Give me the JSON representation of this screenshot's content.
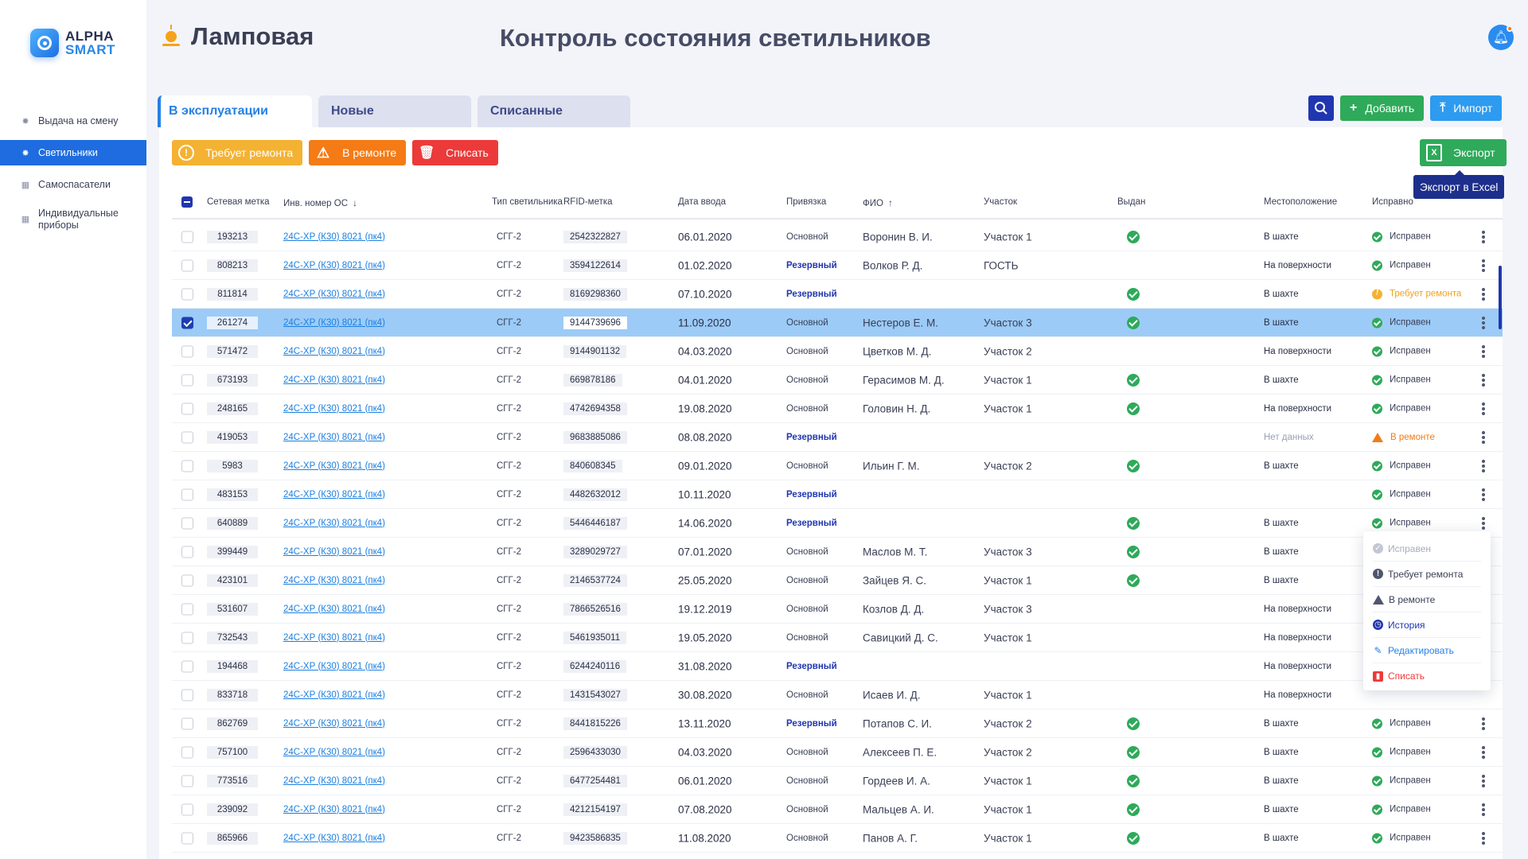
{
  "app": {
    "logo_line1": "ALPHA",
    "logo_line2": "SMART"
  },
  "sidebar": {
    "items": [
      {
        "label": "Выдача на смену",
        "icon": "lamp-icon",
        "active": false
      },
      {
        "label": "Светильники",
        "icon": "lamp-icon",
        "active": true
      },
      {
        "label": "Самоспасатели",
        "icon": "grid-icon",
        "active": false
      },
      {
        "label": "Индивидуальные приборы",
        "icon": "grid-icon",
        "active": false
      }
    ]
  },
  "header": {
    "section": "Ламповая",
    "title": "Контроль состояния светильников"
  },
  "tabs": [
    {
      "label": "В эксплуатации",
      "active": true
    },
    {
      "label": "Новые",
      "active": false
    },
    {
      "label": "Списанные",
      "active": false
    }
  ],
  "actions": {
    "add": "Добавить",
    "import": "Импорт",
    "export": "Экспорт",
    "export_tooltip": "Экспорт в Excel"
  },
  "filters": {
    "needs_repair": "Требует ремонта",
    "in_repair": "В ремонте",
    "write_off": "Списать"
  },
  "columns": {
    "net_tag": "Сетевая метка",
    "inv_no": "Инв. номер ОС",
    "type": "Тип светильника",
    "rfid": "RFID-метка",
    "date": "Дата ввода",
    "binding": "Привязка",
    "fio": "ФИО",
    "section": "Участок",
    "issued": "Выдан",
    "location": "Местоположение",
    "status": "Исправно"
  },
  "rows": [
    {
      "net": "193213",
      "inv": "24С-ХР (К30) 8021 (пк4)",
      "type": "СГГ-2",
      "rfid": "2542322827",
      "date": "06.01.2020",
      "bind": "Основной",
      "fio": "Воронин В. И.",
      "sec": "Участок 1",
      "issued": true,
      "loc": "В шахте",
      "status": "Исправен",
      "st": "ok",
      "selected": false
    },
    {
      "net": "808213",
      "inv": "24С-ХР (К30) 8021 (пк4)",
      "type": "СГГ-2",
      "rfid": "3594122614",
      "date": "01.02.2020",
      "bind": "Резервный",
      "fio": "Волков Р. Д.",
      "sec": "ГОСТЬ",
      "issued": false,
      "loc": "На поверхности",
      "status": "Исправен",
      "st": "ok",
      "selected": false
    },
    {
      "net": "811814",
      "inv": "24С-ХР (К30) 8021 (пк4)",
      "type": "СГГ-2",
      "rfid": "8169298360",
      "date": "07.10.2020",
      "bind": "Резервный",
      "fio": "",
      "sec": "",
      "issued": true,
      "loc": "В шахте",
      "status": "Требует ремонта",
      "st": "warn",
      "selected": false
    },
    {
      "net": "261274",
      "inv": "24С-ХР (К30) 8021 (пк4)",
      "type": "СГГ-2",
      "rfid": "9144739696",
      "date": "11.09.2020",
      "bind": "Основной",
      "fio": "Нестеров Е. М.",
      "sec": "Участок 3",
      "issued": true,
      "loc": "В шахте",
      "status": "Исправен",
      "st": "ok",
      "selected": true
    },
    {
      "net": "571472",
      "inv": "24С-ХР (К30) 8021 (пк4)",
      "type": "СГГ-2",
      "rfid": "9144901132",
      "date": "04.03.2020",
      "bind": "Основной",
      "fio": "Цветков М. Д.",
      "sec": "Участок 2",
      "issued": false,
      "loc": "На поверхности",
      "status": "Исправен",
      "st": "ok",
      "selected": false
    },
    {
      "net": "673193",
      "inv": "24С-ХР (К30) 8021 (пк4)",
      "type": "СГГ-2",
      "rfid": "669878186",
      "date": "04.01.2020",
      "bind": "Основной",
      "fio": "Герасимов М. Д.",
      "sec": "Участок 1",
      "issued": true,
      "loc": "В шахте",
      "status": "Исправен",
      "st": "ok",
      "selected": false
    },
    {
      "net": "248165",
      "inv": "24С-ХР (К30) 8021 (пк4)",
      "type": "СГГ-2",
      "rfid": "4742694358",
      "date": "19.08.2020",
      "bind": "Основной",
      "fio": "Головин Н. Д.",
      "sec": "Участок 1",
      "issued": true,
      "loc": "На поверхности",
      "status": "Исправен",
      "st": "ok",
      "selected": false
    },
    {
      "net": "419053",
      "inv": "24С-ХР (К30) 8021 (пк4)",
      "type": "СГГ-2",
      "rfid": "9683885086",
      "date": "08.08.2020",
      "bind": "Резервный",
      "fio": "",
      "sec": "",
      "issued": false,
      "loc": "Нет данных",
      "status": "В ремонте",
      "st": "rep",
      "selected": false
    },
    {
      "net": "5983",
      "inv": "24С-ХР (К30) 8021 (пк4)",
      "type": "СГГ-2",
      "rfid": "840608345",
      "date": "09.01.2020",
      "bind": "Основной",
      "fio": "Ильин Г. М.",
      "sec": "Участок 2",
      "issued": true,
      "loc": "В шахте",
      "status": "Исправен",
      "st": "ok",
      "selected": false
    },
    {
      "net": "483153",
      "inv": "24С-ХР (К30) 8021 (пк4)",
      "type": "СГГ-2",
      "rfid": "4482632012",
      "date": "10.11.2020",
      "bind": "Резервный",
      "fio": "",
      "sec": "",
      "issued": false,
      "loc": "",
      "status": "Исправен",
      "st": "ok",
      "selected": false
    },
    {
      "net": "640889",
      "inv": "24С-ХР (К30) 8021 (пк4)",
      "type": "СГГ-2",
      "rfid": "5446446187",
      "date": "14.06.2020",
      "bind": "Резервный",
      "fio": "",
      "sec": "",
      "issued": true,
      "loc": "В шахте",
      "status": "Исправен",
      "st": "ok",
      "selected": false
    },
    {
      "net": "399449",
      "inv": "24С-ХР (К30) 8021 (пк4)",
      "type": "СГГ-2",
      "rfid": "3289029727",
      "date": "07.01.2020",
      "bind": "Основной",
      "fio": "Маслов М. Т.",
      "sec": "Участок 3",
      "issued": true,
      "loc": "В шахте",
      "status": "",
      "st": "",
      "selected": false
    },
    {
      "net": "423101",
      "inv": "24С-ХР (К30) 8021 (пк4)",
      "type": "СГГ-2",
      "rfid": "2146537724",
      "date": "25.05.2020",
      "bind": "Основной",
      "fio": "Зайцев Я. С.",
      "sec": "Участок 1",
      "issued": true,
      "loc": "В шахте",
      "status": "",
      "st": "",
      "selected": false
    },
    {
      "net": "531607",
      "inv": "24С-ХР (К30) 8021 (пк4)",
      "type": "СГГ-2",
      "rfid": "7866526516",
      "date": "19.12.2019",
      "bind": "Основной",
      "fio": "Козлов Д. Д.",
      "sec": "Участок 3",
      "issued": false,
      "loc": "На поверхности",
      "status": "",
      "st": "",
      "selected": false
    },
    {
      "net": "732543",
      "inv": "24С-ХР (К30) 8021 (пк4)",
      "type": "СГГ-2",
      "rfid": "5461935011",
      "date": "19.05.2020",
      "bind": "Основной",
      "fio": "Савицкий Д. С.",
      "sec": "Участок 1",
      "issued": false,
      "loc": "На поверхности",
      "status": "",
      "st": "",
      "selected": false
    },
    {
      "net": "194468",
      "inv": "24С-ХР (К30) 8021 (пк4)",
      "type": "СГГ-2",
      "rfid": "6244240116",
      "date": "31.08.2020",
      "bind": "Резервный",
      "fio": "",
      "sec": "",
      "issued": false,
      "loc": "На поверхности",
      "status": "",
      "st": "",
      "selected": false
    },
    {
      "net": "833718",
      "inv": "24С-ХР (К30) 8021 (пк4)",
      "type": "СГГ-2",
      "rfid": "1431543027",
      "date": "30.08.2020",
      "bind": "Основной",
      "fio": "Исаев И. Д.",
      "sec": "Участок 1",
      "issued": false,
      "loc": "На поверхности",
      "status": "",
      "st": "",
      "selected": false
    },
    {
      "net": "862769",
      "inv": "24С-ХР (К30) 8021 (пк4)",
      "type": "СГГ-2",
      "rfid": "8441815226",
      "date": "13.11.2020",
      "bind": "Резервный",
      "fio": "Потапов С. И.",
      "sec": "Участок 2",
      "issued": true,
      "loc": "В шахте",
      "status": "Исправен",
      "st": "ok",
      "selected": false
    },
    {
      "net": "757100",
      "inv": "24С-ХР (К30) 8021 (пк4)",
      "type": "СГГ-2",
      "rfid": "2596433030",
      "date": "04.03.2020",
      "bind": "Основной",
      "fio": "Алексеев П. Е.",
      "sec": "Участок 2",
      "issued": true,
      "loc": "В шахте",
      "status": "Исправен",
      "st": "ok",
      "selected": false
    },
    {
      "net": "773516",
      "inv": "24С-ХР (К30) 8021 (пк4)",
      "type": "СГГ-2",
      "rfid": "6477254481",
      "date": "06.01.2020",
      "bind": "Основной",
      "fio": "Гордеев И. А.",
      "sec": "Участок 1",
      "issued": true,
      "loc": "В шахте",
      "status": "Исправен",
      "st": "ok",
      "selected": false
    },
    {
      "net": "239092",
      "inv": "24С-ХР (К30) 8021 (пк4)",
      "type": "СГГ-2",
      "rfid": "4212154197",
      "date": "07.08.2020",
      "bind": "Основной",
      "fio": "Мальцев А. И.",
      "sec": "Участок 1",
      "issued": true,
      "loc": "В шахте",
      "status": "Исправен",
      "st": "ok",
      "selected": false
    },
    {
      "net": "865966",
      "inv": "24С-ХР (К30) 8021 (пк4)",
      "type": "СГГ-2",
      "rfid": "9423586835",
      "date": "11.08.2020",
      "bind": "Основной",
      "fio": "Панов А. Г.",
      "sec": "Участок 1",
      "issued": true,
      "loc": "В шахте",
      "status": "Исправен",
      "st": "ok",
      "selected": false
    }
  ],
  "context_menu": [
    {
      "label": "Исправен",
      "kind": "disabled",
      "icon": "check-circle-icon"
    },
    {
      "label": "Требует ремонта",
      "kind": "dark",
      "icon": "exclamation-circle-icon"
    },
    {
      "label": "В ремонте",
      "kind": "dark-tri",
      "icon": "warning-triangle-icon"
    },
    {
      "label": "История",
      "kind": "blue",
      "icon": "history-icon"
    },
    {
      "label": "Редактировать",
      "kind": "link",
      "icon": "pencil-icon"
    },
    {
      "label": "Списать",
      "kind": "red",
      "icon": "trash-icon"
    }
  ],
  "colors": {
    "primary": "#1e6ce0",
    "navy": "#2036b0",
    "green": "#2eaa5a",
    "orange": "#f47b16",
    "yellow": "#f4b233",
    "red": "#ec3a3a",
    "selected_row": "#9ccbf7"
  }
}
